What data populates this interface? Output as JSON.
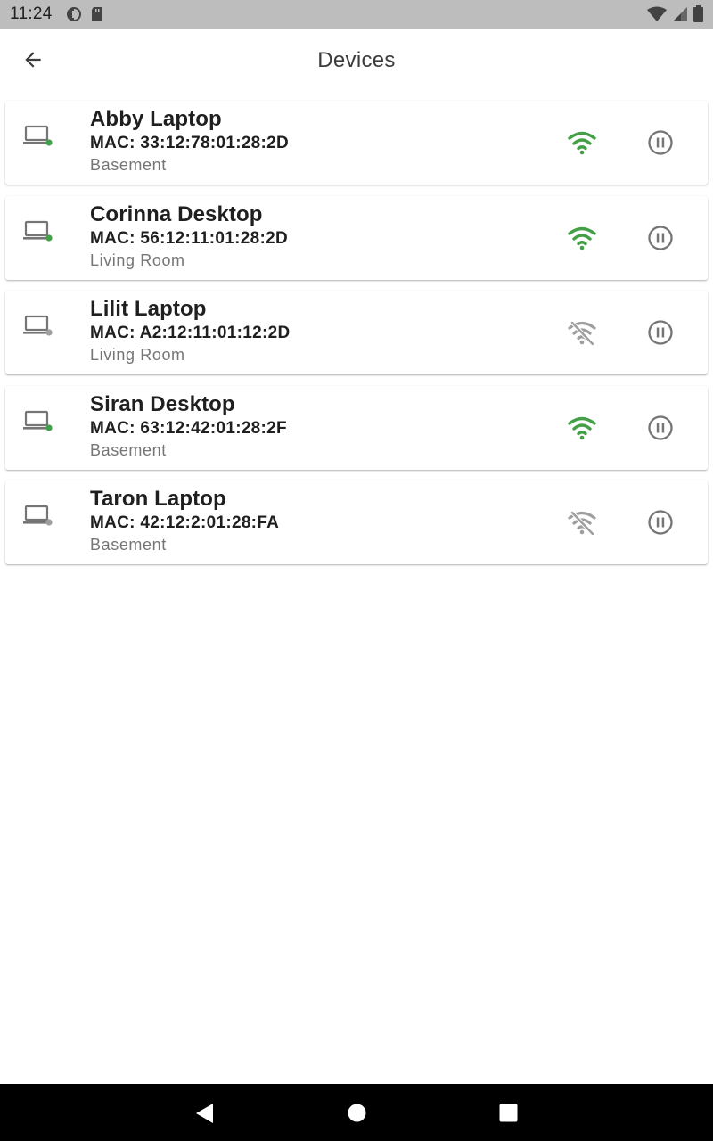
{
  "status_bar": {
    "time": "11:24"
  },
  "app_bar": {
    "title": "Devices"
  },
  "colors": {
    "online": "#43a047",
    "offline": "#9e9e9e",
    "icon": "#757575"
  },
  "devices": [
    {
      "name": "Abby Laptop",
      "mac": "MAC: 33:12:78:01:28:2D",
      "location": "Basement",
      "online": true
    },
    {
      "name": "Corinna Desktop",
      "mac": "MAC: 56:12:11:01:28:2D",
      "location": "Living Room",
      "online": true
    },
    {
      "name": "Lilit Laptop",
      "mac": "MAC: A2:12:11:01:12:2D",
      "location": "Living Room",
      "online": false
    },
    {
      "name": "Siran Desktop",
      "mac": "MAC: 63:12:42:01:28:2F",
      "location": "Basement",
      "online": true
    },
    {
      "name": "Taron Laptop",
      "mac": "MAC: 42:12:2:01:28:FA",
      "location": "Basement",
      "online": false
    }
  ]
}
